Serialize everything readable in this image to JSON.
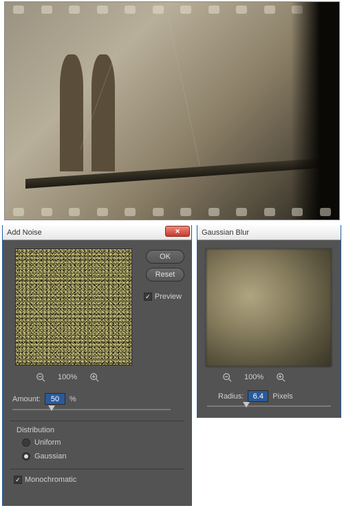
{
  "hero": {
    "name": "bridge-film-photo"
  },
  "addNoise": {
    "title": "Add Noise",
    "okLabel": "OK",
    "resetLabel": "Reset",
    "previewLabel": "Preview",
    "previewChecked": true,
    "zoomOutIcon": "zoom-out",
    "zoomInIcon": "zoom-in",
    "zoomLevel": "100%",
    "amountLabel": "Amount:",
    "amountValue": "50",
    "amountUnit": "%",
    "distributionLabel": "Distribution",
    "radioUniform": "Uniform",
    "radioGaussian": "Gaussian",
    "selectedDistribution": "Gaussian",
    "monochromaticLabel": "Monochromatic",
    "monochromaticChecked": true
  },
  "gaussianBlur": {
    "title": "Gaussian Blur",
    "zoomLevel": "100%",
    "radiusLabel": "Radius:",
    "radiusValue": "6.4",
    "radiusUnit": "Pixels"
  }
}
